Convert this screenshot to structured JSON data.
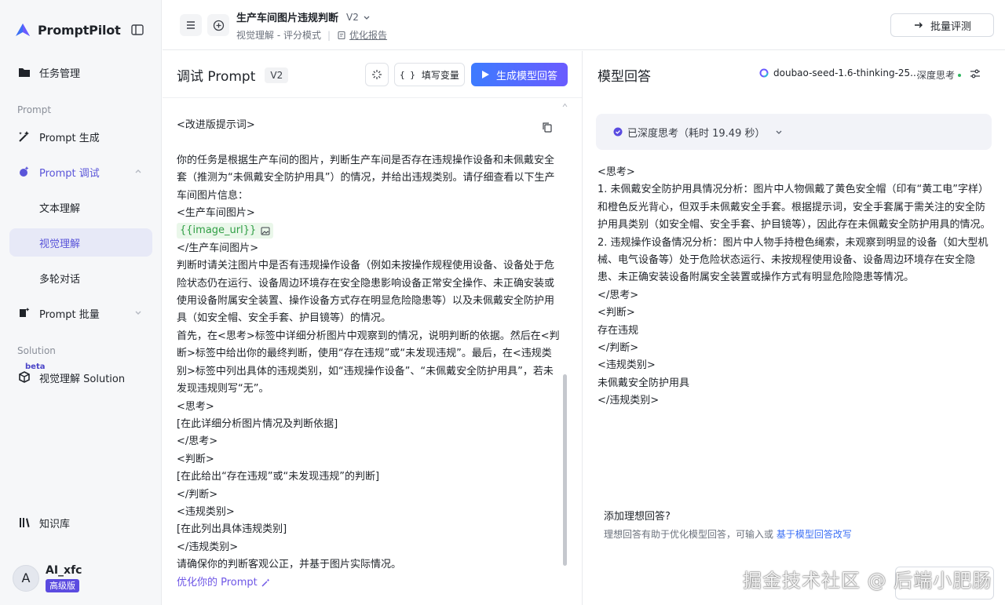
{
  "app": {
    "brand": "PromptPilot"
  },
  "sidebar": {
    "items": {
      "tasks": "任务管理",
      "prompt_gen": "Prompt 生成",
      "prompt_debug": "Prompt 调试",
      "text_understanding": "文本理解",
      "visual_understanding": "视觉理解",
      "multi_turn": "多轮对话",
      "prompt_batch": "Prompt 批量",
      "visual_solution": "视觉理解 Solution",
      "knowledge": "知识库"
    },
    "sections": {
      "prompt": "Prompt",
      "solution": "Solution"
    },
    "beta": "beta",
    "user": {
      "initial": "A",
      "name": "AI_xfc",
      "tier": "高级版"
    }
  },
  "header": {
    "project_title": "生产车间图片违规判断",
    "version": "V2",
    "mode": "视觉理解 - 评分模式",
    "report_link": "优化报告",
    "batch_button": "批量评测"
  },
  "prompt_pane": {
    "title": "调试 Prompt",
    "version_chip": "V2",
    "fill_vars_button": "填写变量",
    "fill_vars_glyph": "{ }",
    "generate_button": "生成模型回答",
    "lines": {
      "l1": "<改进版提示词>",
      "l2": "你的任务是根据生产车间的图片，判断生产车间是否存在违规操作设备和未佩戴安全套（推测为“未佩戴安全防护用具”）的情况，并给出违规类别。请仔细查看以下生产车间图片信息：",
      "l3": "<生产车间图片>",
      "var": "{{image_url}}",
      "l4": "</生产车间图片>",
      "l5": "判断时请关注图片中是否有违规操作设备（例如未按操作规程使用设备、设备处于危险状态仍在运行、设备周边环境存在安全隐患影响设备正常安全操作、未正确安装或使用设备附属安全装置、操作设备方式存在明显危险隐患等）以及未佩戴安全防护用具（如安全帽、安全手套、护目镜等）的情况。",
      "l6": "首先，在<思考>标签中详细分析图片中观察到的情况，说明判断的依据。然后在<判断>标签中给出你的最终判断，使用“存在违规”或“未发现违规”。最后，在<违规类别>标签中列出具体的违规类别，如“违规操作设备”、“未佩戴安全防护用具”，若未发现违规则写“无”。",
      "l7": "<思考>",
      "l8": "[在此详细分析图片情况及判断依据]",
      "l9": "</思考>",
      "l10": "<判断>",
      "l11": "[在此给出“存在违规”或“未发现违规”的判断]",
      "l12": "</判断>",
      "l13": "<违规类别>",
      "l14": "[在此列出具体违规类别]",
      "l15": "</违规类别>",
      "l16": "请确保你的判断客观公正，并基于图片实际情况。"
    },
    "optimize_link": "优化你的 Prompt"
  },
  "response_pane": {
    "title": "模型回答",
    "model_name": "doubao-seed-1.6-thinking-25...",
    "deep_think": "深度思考",
    "thinking_status": "已深度思考（耗时 19.49 秒）",
    "lines": {
      "a1": "<思考>",
      "a2": "1. 未佩戴安全防护用具情况分析：图片中人物佩戴了黄色安全帽（印有“黄工电”字样）和橙色反光背心，但双手未佩戴安全手套。根据提示词，安全手套属于需关注的安全防护用具类别（如安全帽、安全手套、护目镜等），因此存在未佩戴安全防护用具的情况。",
      "a3": "2. 违规操作设备情况分析：图片中人物手持橙色绳索，未观察到明显的设备（如大型机械、电气设备等）处于危险状态运行、未按规程使用设备、设备周边环境存在安全隐患、未正确安装设备附属安全装置或操作方式有明显危险隐患等情况。",
      "a4": "</思考>",
      "a5": "<判断>",
      "a6": "存在违规",
      "a7": "</判断>",
      "a8": "<违规类别>",
      "a9": "未佩戴安全防护用具",
      "a10": "</违规类别>"
    },
    "ideal_title": "添加理想回答?",
    "ideal_desc": "理想回答有助于优化模型回答，可输入或 ",
    "ideal_link": "基于模型回答改写"
  },
  "watermark": "掘金技术社区 @ 后端小肥肠",
  "colors": {
    "accent": "#5a55d9",
    "primary_gradient_start": "#3d7bff",
    "primary_gradient_end": "#6a5bff",
    "variable_green": "#2f9e44"
  }
}
